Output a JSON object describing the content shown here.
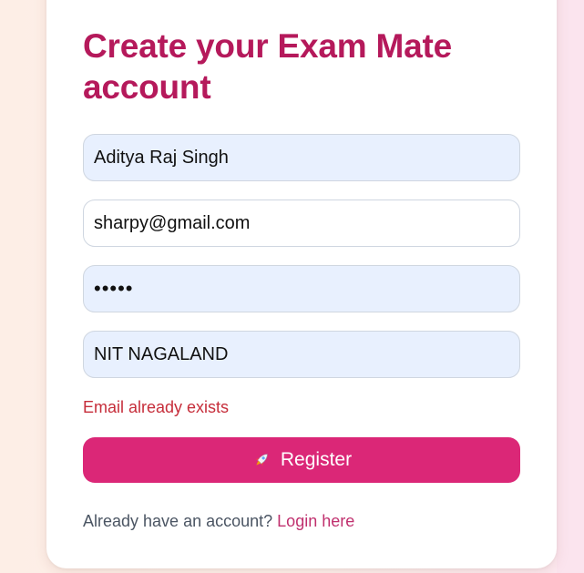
{
  "form": {
    "title": "Create your Exam Mate account",
    "name_value": "Aditya Raj Singh",
    "email_value": "sharpy@gmail.com",
    "password_value": "hello",
    "institute_value": "NIT NAGALAND",
    "error_text": "Email already exists",
    "register_label": "Register",
    "register_icon": "rocket-icon",
    "footer_prompt": "Already have an account?",
    "login_link_label": "Login here"
  },
  "colors": {
    "title": "#b5195b",
    "button": "#db2777",
    "error": "#c62d3a",
    "link": "#c0306e",
    "autofill_bg": "#e8f0fe"
  }
}
